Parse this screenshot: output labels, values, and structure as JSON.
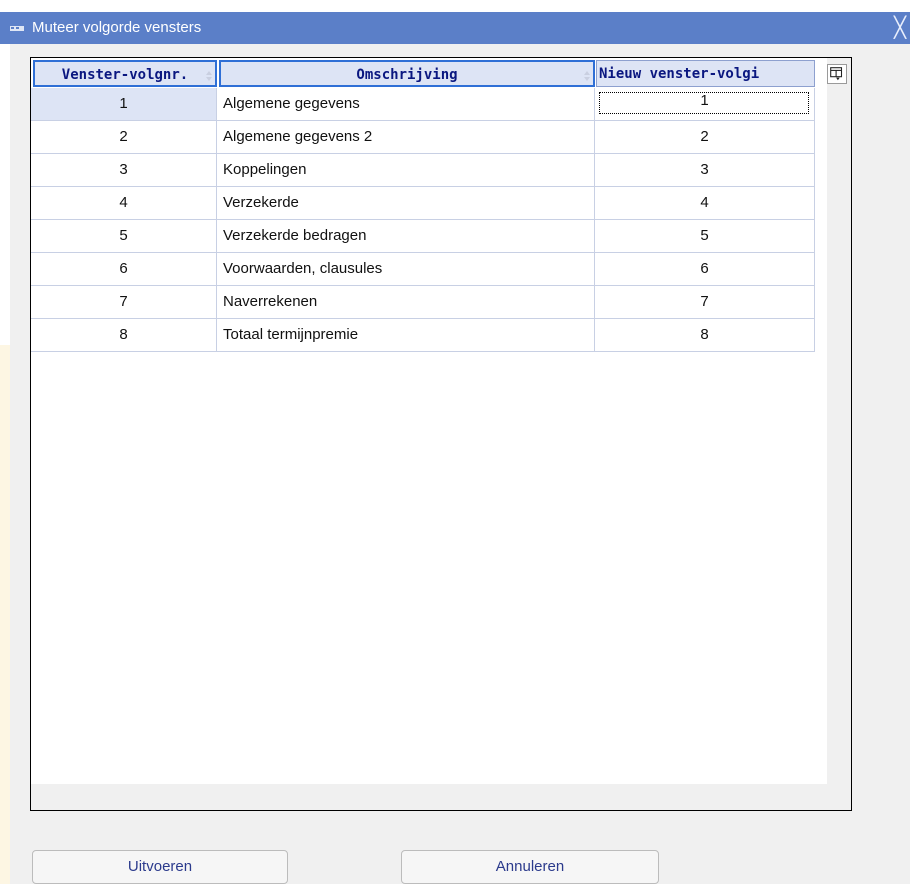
{
  "window": {
    "title": "Muteer volgorde vensters",
    "close_glyph": "╳",
    "titlebar_color": "#5b7fc8"
  },
  "table": {
    "columns": [
      {
        "label": "Venster-volgnr."
      },
      {
        "label": "Omschrijving"
      },
      {
        "label": "Nieuw venster-volgi"
      }
    ],
    "rows": [
      {
        "nr": "1",
        "omschrijving": "Algemene gegevens",
        "nieuw": "1"
      },
      {
        "nr": "2",
        "omschrijving": "Algemene gegevens 2",
        "nieuw": "2"
      },
      {
        "nr": "3",
        "omschrijving": "Koppelingen",
        "nieuw": "3"
      },
      {
        "nr": "4",
        "omschrijving": "Verzekerde",
        "nieuw": "4"
      },
      {
        "nr": "5",
        "omschrijving": "Verzekerde bedragen",
        "nieuw": "5"
      },
      {
        "nr": "6",
        "omschrijving": "Voorwaarden, clausules",
        "nieuw": "6"
      },
      {
        "nr": "7",
        "omschrijving": "Naverrekenen",
        "nieuw": "7"
      },
      {
        "nr": "8",
        "omschrijving": "Totaal termijnpremie",
        "nieuw": "8"
      }
    ],
    "header_color": "#dde4f5",
    "header_text_color": "#0a1780"
  },
  "buttons": {
    "execute_label": "Uitvoeren",
    "cancel_label": "Annuleren"
  }
}
